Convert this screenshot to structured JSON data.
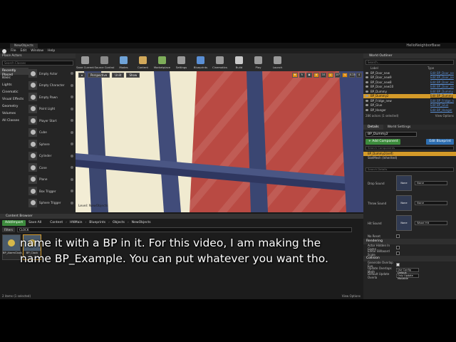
{
  "window": {
    "tab_title": "NewObjects",
    "project": "HelloNeighborBase"
  },
  "menu": [
    "File",
    "Edit",
    "Window",
    "Help"
  ],
  "modes": {
    "title": "Place Actors",
    "search_placeholder": "Search Classes",
    "categories": [
      "Recently Placed",
      "Basic",
      "Lights",
      "Cinematic",
      "Visual Effects",
      "Geometry",
      "Volumes",
      "All Classes"
    ],
    "selected_category": "Recently Placed",
    "items": [
      "Empty Actor",
      "Empty Character",
      "Empty Pawn",
      "Point Light",
      "Player Start",
      "Cube",
      "Sphere",
      "Cylinder",
      "Cone",
      "Plane",
      "Box Trigger",
      "Sphere Trigger"
    ]
  },
  "toolbar": [
    {
      "label": "Save Current",
      "icon": "save-icon",
      "color": "#9a9a9a"
    },
    {
      "label": "Source Control",
      "icon": "source-control-icon",
      "color": "#8a8a8a"
    },
    {
      "label": "Modes",
      "icon": "modes-icon",
      "color": "#6fa3d8"
    },
    {
      "label": "Content",
      "icon": "content-icon",
      "color": "#d2a95a"
    },
    {
      "label": "Marketplace",
      "icon": "marketplace-icon",
      "color": "#7fae5a"
    },
    {
      "label": "Settings",
      "icon": "settings-icon",
      "color": "#9a9a9a"
    },
    {
      "label": "Blueprints",
      "icon": "blueprints-icon",
      "color": "#5a8fd5"
    },
    {
      "label": "Cinematics",
      "icon": "cinematics-icon",
      "color": "#9a9a9a"
    },
    {
      "label": "Build",
      "icon": "build-icon",
      "color": "#c9c9c9"
    },
    {
      "label": "Play",
      "icon": "play-icon",
      "color": "#9a9a9a"
    },
    {
      "label": "Launch",
      "icon": "launch-icon",
      "color": "#9a9a9a"
    }
  ],
  "viewport": {
    "buttons": [
      "Perspective",
      "Unlit",
      "Show"
    ],
    "right_values": [
      "10",
      "10°",
      "0.25",
      "4"
    ],
    "level": "Level: NewObjects"
  },
  "outliner": {
    "title": "World Outliner",
    "search_placeholder": "Search...",
    "col_label": "Label",
    "col_type": "Type",
    "rows": [
      {
        "label": "BP_Door_new",
        "type": "Edit BP_Door_ne"
      },
      {
        "label": "BP_Door_new9",
        "type": "Edit BP_Door_ne"
      },
      {
        "label": "BP_Door_new8",
        "type": "Edit BP_Door_ne"
      },
      {
        "label": "BP_Door_new10",
        "type": "Edit BP_Door_ne"
      },
      {
        "label": "BP_Dummy",
        "type": "Edit BP_Dummy"
      },
      {
        "label": "BP_Dummy2",
        "type": "Edit BP_Dummy",
        "selected": true
      },
      {
        "label": "BP_Fridge_new",
        "type": "Edit BP_Fridge_n"
      },
      {
        "label": "BP_Glue",
        "type": "Edit BP_Glue"
      },
      {
        "label": "BP_Hanger",
        "type": "Edit BP_Hanger"
      }
    ],
    "footer_count": "286 actors (1 selected)",
    "footer_options": "View Options"
  },
  "details": {
    "tabs": [
      "Details",
      "World Settings"
    ],
    "name_value": "BP_Dummy2",
    "add_component": "+ Add Component",
    "edit_blueprint": "Edit Blueprint",
    "components_search": "Search Components",
    "components": [
      "BP_Dummy2(self)",
      "SkelMesh (Inherited)"
    ],
    "search_details": "Search Details",
    "sound_props": [
      {
        "label": "Drop Sound",
        "thumb": "None",
        "value": "None"
      },
      {
        "label": "Throw Sound",
        "thumb": "None",
        "value": "None"
      },
      {
        "label": "Hit Sound",
        "thumb": "None",
        "value": "Wood Hit"
      }
    ],
    "rows": [
      {
        "label": "No Reset",
        "checked": false
      },
      {
        "label": "Rendering",
        "section": true
      },
      {
        "label": "Actor Hidden In Game",
        "checked": false
      },
      {
        "label": "Editor Billboard Scale",
        "checked": false
      }
    ],
    "collision": {
      "title": "Collision",
      "rows": [
        {
          "label": "Generate Overlap Eve",
          "value": "",
          "checked": true
        },
        {
          "label": "Update Overlaps Meth",
          "value": "Use Config Default"
        },
        {
          "label": "Default Update Overla",
          "value": "Only Update Movable"
        }
      ]
    }
  },
  "content_browser": {
    "title": "Content Browser",
    "add_import": "Add/Import",
    "save_all": "Save All",
    "breadcrumbs": [
      "Content",
      "HNMain",
      "Blueprints",
      "Objects",
      "NewObjects"
    ],
    "filters_label": "Filters",
    "search_value": "CLOCK",
    "assets": [
      {
        "name": "BP_AlarmClock_new",
        "selected": false
      },
      {
        "name": "BP_Clock",
        "selected": true
      }
    ],
    "footer": "2 items (1 selected)",
    "view_options": "View Options"
  },
  "subtitle": {
    "line1": "name it with a BP in it. For this video, I am making the",
    "line2": "name BP_Example. You can put whatever you want tho."
  }
}
